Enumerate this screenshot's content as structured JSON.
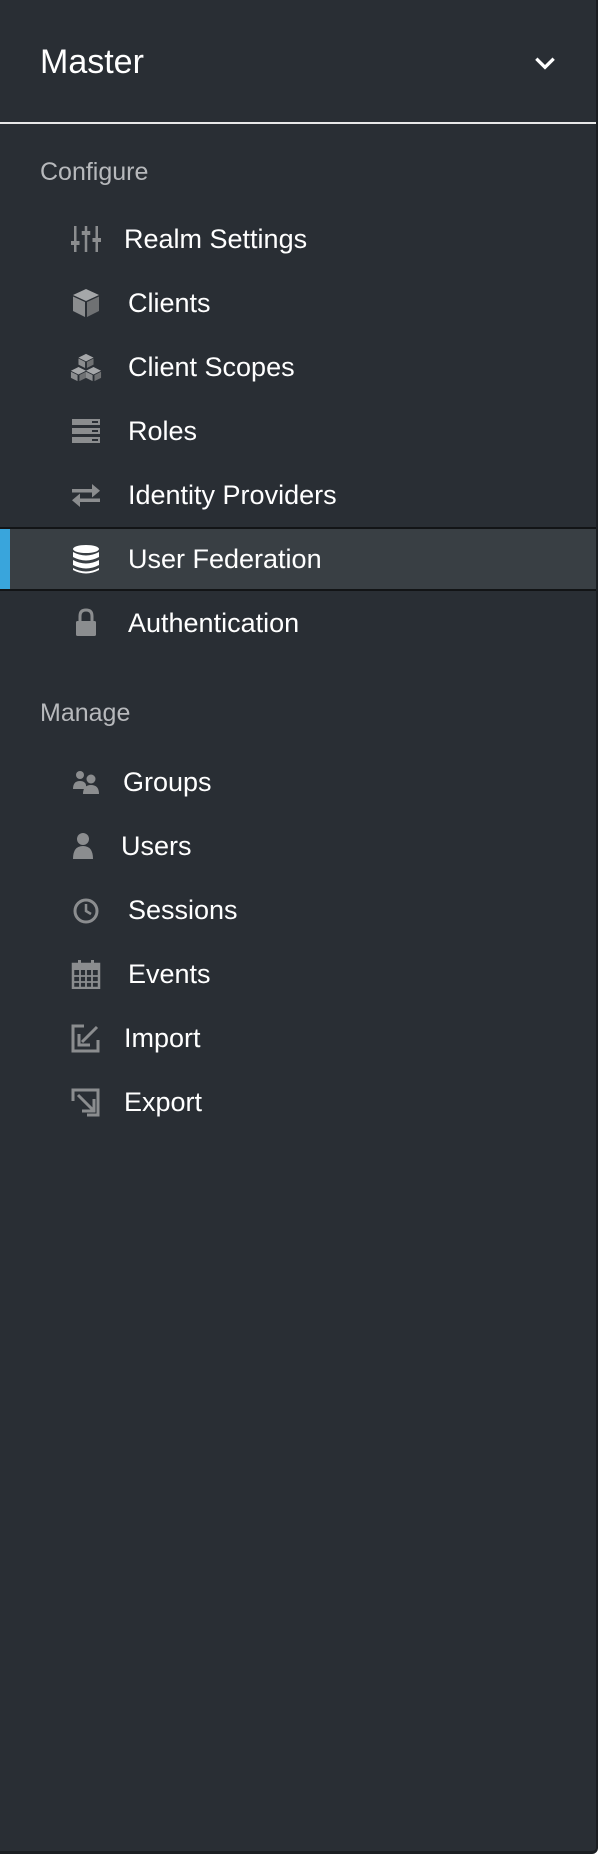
{
  "realm": {
    "name": "Master",
    "icon": "chevron-down-icon"
  },
  "configure": {
    "label": "Configure",
    "items": [
      {
        "label": "Realm Settings",
        "icon": "sliders-icon"
      },
      {
        "label": "Clients",
        "icon": "cube-icon"
      },
      {
        "label": "Client Scopes",
        "icon": "cubes-icon"
      },
      {
        "label": "Roles",
        "icon": "server-icon"
      },
      {
        "label": "Identity Providers",
        "icon": "exchange-icon"
      },
      {
        "label": "User Federation",
        "icon": "database-icon",
        "active": true
      },
      {
        "label": "Authentication",
        "icon": "lock-icon"
      }
    ]
  },
  "manage": {
    "label": "Manage",
    "items": [
      {
        "label": "Groups",
        "icon": "users-icon"
      },
      {
        "label": "Users",
        "icon": "user-icon"
      },
      {
        "label": "Sessions",
        "icon": "clock-icon"
      },
      {
        "label": "Events",
        "icon": "calendar-icon"
      },
      {
        "label": "Import",
        "icon": "import-icon"
      },
      {
        "label": "Export",
        "icon": "export-icon"
      }
    ]
  },
  "colors": {
    "sidebar_bg": "#292e34",
    "active_bg": "#393f44",
    "active_accent": "#39a5dc",
    "icon": "#8b8d8f",
    "section_label": "#b7b9bc",
    "text": "#ffffff"
  }
}
